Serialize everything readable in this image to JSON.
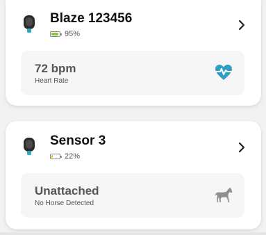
{
  "devices": [
    {
      "name": "Blaze 123456",
      "battery_percent_label": "95%",
      "battery_level": 0.95,
      "battery_color": "#8cc63f",
      "status_value": "72 bpm",
      "status_label": "Heart Rate",
      "status_icon": "heart-pulse-icon",
      "status_icon_color": "#2f9fc4"
    },
    {
      "name": "Sensor 3",
      "battery_percent_label": "22%",
      "battery_level": 0.22,
      "battery_color": "#f2c200",
      "status_value": "Unattached",
      "status_label": "No Horse Detected",
      "status_icon": "horse-icon",
      "status_icon_color": "#8f8f8f"
    }
  ]
}
